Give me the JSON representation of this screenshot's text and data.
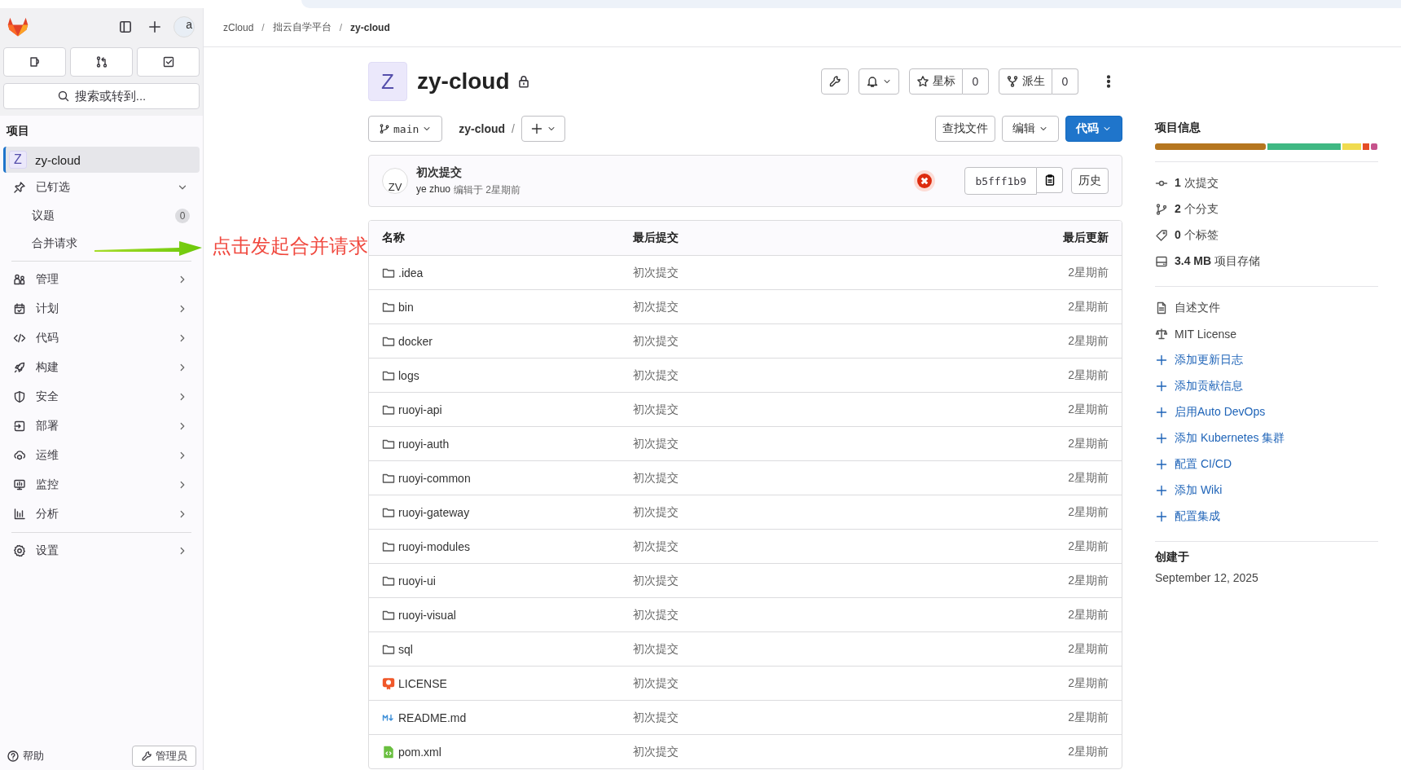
{
  "sidebar": {
    "user_avatar": "a",
    "quick_buttons": [
      {
        "kind": "issues"
      },
      {
        "kind": "merge"
      },
      {
        "kind": "todo"
      }
    ],
    "search_label": "搜索或转到...",
    "section_title": "项目",
    "project": {
      "avatar": "Z",
      "name": "zy-cloud",
      "selected": true
    },
    "pinned": {
      "label": "已钉选",
      "expanded": true,
      "items": [
        {
          "label": "议题",
          "count": "0"
        },
        {
          "label": "合并请求"
        }
      ]
    },
    "nav": [
      {
        "kind": "users",
        "label": "管理"
      },
      {
        "kind": "calendar",
        "label": "计划"
      },
      {
        "kind": "code",
        "label": "代码"
      },
      {
        "kind": "rocket",
        "label": "构建"
      },
      {
        "kind": "shield",
        "label": "安全"
      },
      {
        "kind": "deploy",
        "label": "部署"
      },
      {
        "kind": "ops",
        "label": "运维"
      },
      {
        "kind": "monitor",
        "label": "监控"
      },
      {
        "kind": "chart",
        "label": "分析"
      }
    ],
    "settings": {
      "kind": "gear",
      "label": "设置"
    },
    "footer": {
      "help": "帮助",
      "admin": "管理员"
    }
  },
  "annotation": {
    "text": "点击发起合并请求"
  },
  "breadcrumb": [
    "zCloud",
    "拙云自学平台",
    "zy-cloud"
  ],
  "project_header": {
    "avatar": "Z",
    "title": "zy-cloud",
    "locked": true,
    "star_label": "星标",
    "star_count": "0",
    "fork_label": "派生",
    "fork_count": "0"
  },
  "toolbar": {
    "branch": "main",
    "path": "zy-cloud",
    "separator": "/",
    "find": "查找文件",
    "edit": "编辑",
    "code": "代码"
  },
  "commit": {
    "avatar": "ZV",
    "title": "初次提交",
    "author": "ye zhuo",
    "meta": "编辑于 2星期前",
    "pipeline_failed": true,
    "sha": "b5fff1b9",
    "history": "历史"
  },
  "table": {
    "columns": [
      "名称",
      "最后提交",
      "最后更新"
    ],
    "rows": [
      {
        "kind": "folder",
        "name": ".idea",
        "commit": "初次提交",
        "updated": "2星期前"
      },
      {
        "kind": "folder",
        "name": "bin",
        "commit": "初次提交",
        "updated": "2星期前"
      },
      {
        "kind": "folder",
        "name": "docker",
        "commit": "初次提交",
        "updated": "2星期前"
      },
      {
        "kind": "folder",
        "name": "logs",
        "commit": "初次提交",
        "updated": "2星期前"
      },
      {
        "kind": "folder",
        "name": "ruoyi-api",
        "commit": "初次提交",
        "updated": "2星期前"
      },
      {
        "kind": "folder",
        "name": "ruoyi-auth",
        "commit": "初次提交",
        "updated": "2星期前"
      },
      {
        "kind": "folder",
        "name": "ruoyi-common",
        "commit": "初次提交",
        "updated": "2星期前"
      },
      {
        "kind": "folder",
        "name": "ruoyi-gateway",
        "commit": "初次提交",
        "updated": "2星期前"
      },
      {
        "kind": "folder",
        "name": "ruoyi-modules",
        "commit": "初次提交",
        "updated": "2星期前"
      },
      {
        "kind": "folder",
        "name": "ruoyi-ui",
        "commit": "初次提交",
        "updated": "2星期前"
      },
      {
        "kind": "folder",
        "name": "ruoyi-visual",
        "commit": "初次提交",
        "updated": "2星期前"
      },
      {
        "kind": "folder",
        "name": "sql",
        "commit": "初次提交",
        "updated": "2星期前"
      },
      {
        "kind": "license",
        "name": "LICENSE",
        "commit": "初次提交",
        "updated": "2星期前"
      },
      {
        "kind": "markdown",
        "name": "README.md",
        "commit": "初次提交",
        "updated": "2星期前"
      },
      {
        "kind": "xml",
        "name": "pom.xml",
        "commit": "初次提交",
        "updated": "2星期前"
      }
    ]
  },
  "project_info": {
    "title": "项目信息",
    "stats": [
      {
        "kind": "commit",
        "text": "**1** 次提交"
      },
      {
        "kind": "branch",
        "text": "**2** 个分支"
      },
      {
        "kind": "tag",
        "text": "**0** 个标签"
      },
      {
        "kind": "storage",
        "text": "**3.4 MB** 项目存储"
      }
    ],
    "links": [
      {
        "kind": "file",
        "label": "自述文件"
      },
      {
        "kind": "license",
        "label": "MIT License"
      },
      {
        "kind": "add",
        "label": "添加更新日志"
      },
      {
        "kind": "add",
        "label": "添加贡献信息"
      },
      {
        "kind": "add",
        "label": "启用Auto DevOps"
      },
      {
        "kind": "add",
        "label": "添加 Kubernetes 集群"
      },
      {
        "kind": "add",
        "label": "配置 CI/CD"
      },
      {
        "kind": "add",
        "label": "添加 Wiki"
      },
      {
        "kind": "add",
        "label": "配置集成"
      }
    ],
    "created_title": "创建于",
    "created": "September 12, 2025"
  }
}
